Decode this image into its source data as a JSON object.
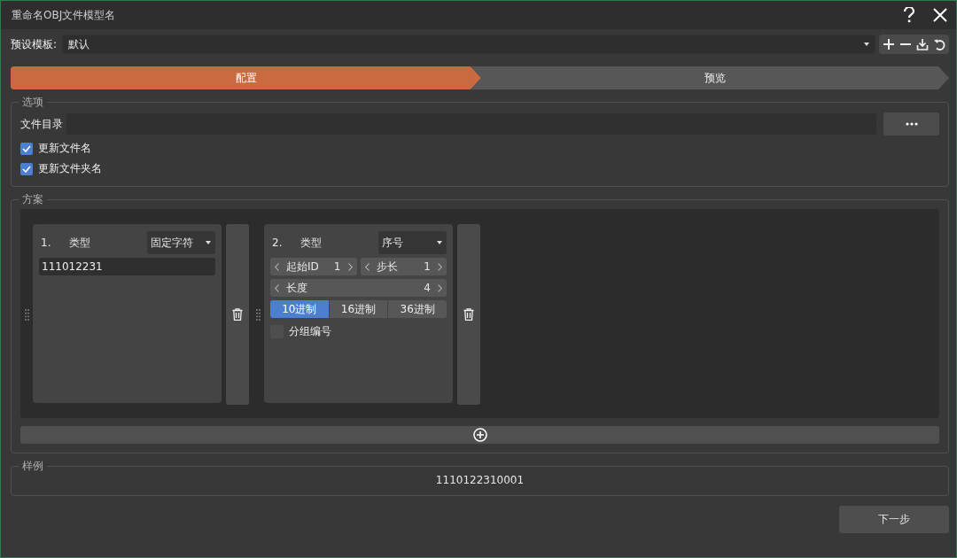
{
  "window": {
    "title": "重命名OBJ文件模型名"
  },
  "preset": {
    "label": "预设模板:",
    "value": "默认"
  },
  "steps": [
    {
      "label": "配置",
      "selected": true
    },
    {
      "label": "预览",
      "selected": false
    }
  ],
  "options": {
    "title": "选项",
    "directory": {
      "label": "文件目录"
    },
    "checkboxes": [
      {
        "label": "更新文件名",
        "checked": true
      },
      {
        "label": "更新文件夹名",
        "checked": true
      }
    ]
  },
  "scheme": {
    "title": "方案",
    "rules": [
      {
        "kind": "text",
        "index": "1.",
        "type_label": "类型",
        "type": "固定字符",
        "value": "111012231"
      },
      {
        "kind": "sequence",
        "index": "2.",
        "type_label": "类型",
        "type": "序号",
        "start": {
          "label": "起始ID",
          "value": "1"
        },
        "step": {
          "label": "步长",
          "value": "1"
        },
        "length": {
          "label": "长度",
          "value": "4"
        },
        "bases": [
          {
            "label": "10进制",
            "selected": true
          },
          {
            "label": "16进制",
            "selected": false
          },
          {
            "label": "36进制",
            "selected": false
          }
        ],
        "group": {
          "label": "分组编号",
          "checked": false
        }
      }
    ]
  },
  "example": {
    "title": "样例",
    "value": "1110122310001"
  },
  "next_button": "下一步"
}
